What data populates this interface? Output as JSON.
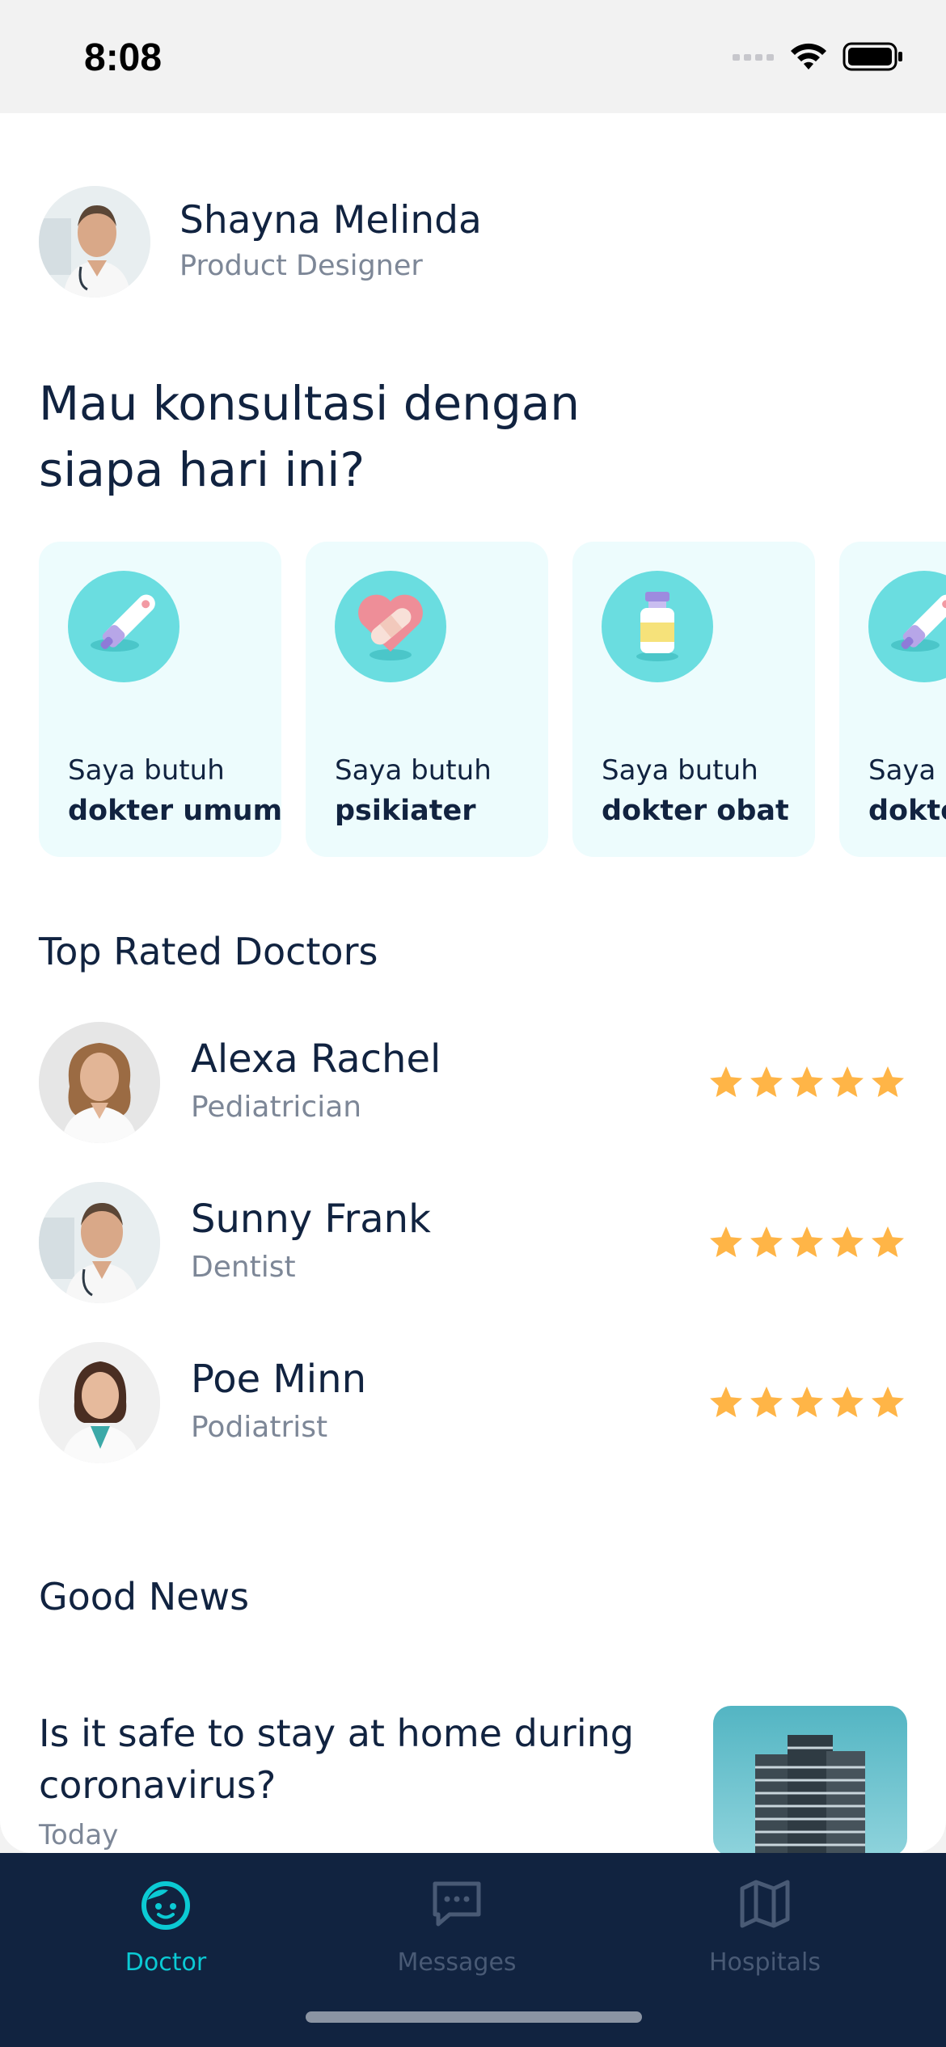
{
  "status": {
    "time": "8:08"
  },
  "profile": {
    "name": "Shayna Melinda",
    "role": "Product Designer"
  },
  "headline": "Mau konsultasi dengan siapa hari ini?",
  "categories": [
    {
      "label": "Saya butuh",
      "title": "dokter umum",
      "icon": "thermometer-icon"
    },
    {
      "label": "Saya butuh",
      "title": "psikiater",
      "icon": "heart-bandage-icon"
    },
    {
      "label": "Saya butuh",
      "title": "dokter obat",
      "icon": "medicine-bottle-icon"
    },
    {
      "label": "Saya butuh",
      "title": "dokter umum",
      "icon": "thermometer-icon"
    }
  ],
  "top_rated": {
    "title": "Top Rated Doctors",
    "doctors": [
      {
        "name": "Alexa Rachel",
        "specialty": "Pediatrician",
        "rating": 5
      },
      {
        "name": "Sunny Frank",
        "specialty": "Dentist",
        "rating": 5
      },
      {
        "name": "Poe Minn",
        "specialty": "Podiatrist",
        "rating": 5
      }
    ]
  },
  "news": {
    "title": "Good News",
    "items": [
      {
        "title": "Is it safe to stay at home during coronavirus?",
        "date": "Today"
      }
    ]
  },
  "tabs": [
    {
      "label": "Doctor",
      "icon": "doctor-face-icon",
      "active": true
    },
    {
      "label": "Messages",
      "icon": "chat-icon",
      "active": false
    },
    {
      "label": "Hospitals",
      "icon": "map-icon",
      "active": false
    }
  ],
  "colors": {
    "primary_dark": "#112340",
    "accent": "#0BCAD4",
    "card_bg": "#EDFCFD",
    "icon_circle": "#6ADDE0",
    "star": "#FFB547",
    "secondary_text": "#7D8797"
  }
}
